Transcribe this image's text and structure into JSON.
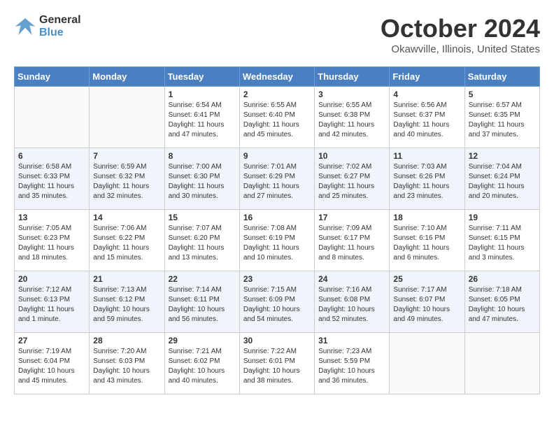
{
  "header": {
    "logo_line1": "General",
    "logo_line2": "Blue",
    "title": "October 2024",
    "subtitle": "Okawville, Illinois, United States"
  },
  "weekdays": [
    "Sunday",
    "Monday",
    "Tuesday",
    "Wednesday",
    "Thursday",
    "Friday",
    "Saturday"
  ],
  "weeks": [
    [
      {
        "day": "",
        "info": ""
      },
      {
        "day": "",
        "info": ""
      },
      {
        "day": "1",
        "info": "Sunrise: 6:54 AM\nSunset: 6:41 PM\nDaylight: 11 hours and 47 minutes."
      },
      {
        "day": "2",
        "info": "Sunrise: 6:55 AM\nSunset: 6:40 PM\nDaylight: 11 hours and 45 minutes."
      },
      {
        "day": "3",
        "info": "Sunrise: 6:55 AM\nSunset: 6:38 PM\nDaylight: 11 hours and 42 minutes."
      },
      {
        "day": "4",
        "info": "Sunrise: 6:56 AM\nSunset: 6:37 PM\nDaylight: 11 hours and 40 minutes."
      },
      {
        "day": "5",
        "info": "Sunrise: 6:57 AM\nSunset: 6:35 PM\nDaylight: 11 hours and 37 minutes."
      }
    ],
    [
      {
        "day": "6",
        "info": "Sunrise: 6:58 AM\nSunset: 6:33 PM\nDaylight: 11 hours and 35 minutes."
      },
      {
        "day": "7",
        "info": "Sunrise: 6:59 AM\nSunset: 6:32 PM\nDaylight: 11 hours and 32 minutes."
      },
      {
        "day": "8",
        "info": "Sunrise: 7:00 AM\nSunset: 6:30 PM\nDaylight: 11 hours and 30 minutes."
      },
      {
        "day": "9",
        "info": "Sunrise: 7:01 AM\nSunset: 6:29 PM\nDaylight: 11 hours and 27 minutes."
      },
      {
        "day": "10",
        "info": "Sunrise: 7:02 AM\nSunset: 6:27 PM\nDaylight: 11 hours and 25 minutes."
      },
      {
        "day": "11",
        "info": "Sunrise: 7:03 AM\nSunset: 6:26 PM\nDaylight: 11 hours and 23 minutes."
      },
      {
        "day": "12",
        "info": "Sunrise: 7:04 AM\nSunset: 6:24 PM\nDaylight: 11 hours and 20 minutes."
      }
    ],
    [
      {
        "day": "13",
        "info": "Sunrise: 7:05 AM\nSunset: 6:23 PM\nDaylight: 11 hours and 18 minutes."
      },
      {
        "day": "14",
        "info": "Sunrise: 7:06 AM\nSunset: 6:22 PM\nDaylight: 11 hours and 15 minutes."
      },
      {
        "day": "15",
        "info": "Sunrise: 7:07 AM\nSunset: 6:20 PM\nDaylight: 11 hours and 13 minutes."
      },
      {
        "day": "16",
        "info": "Sunrise: 7:08 AM\nSunset: 6:19 PM\nDaylight: 11 hours and 10 minutes."
      },
      {
        "day": "17",
        "info": "Sunrise: 7:09 AM\nSunset: 6:17 PM\nDaylight: 11 hours and 8 minutes."
      },
      {
        "day": "18",
        "info": "Sunrise: 7:10 AM\nSunset: 6:16 PM\nDaylight: 11 hours and 6 minutes."
      },
      {
        "day": "19",
        "info": "Sunrise: 7:11 AM\nSunset: 6:15 PM\nDaylight: 11 hours and 3 minutes."
      }
    ],
    [
      {
        "day": "20",
        "info": "Sunrise: 7:12 AM\nSunset: 6:13 PM\nDaylight: 11 hours and 1 minute."
      },
      {
        "day": "21",
        "info": "Sunrise: 7:13 AM\nSunset: 6:12 PM\nDaylight: 10 hours and 59 minutes."
      },
      {
        "day": "22",
        "info": "Sunrise: 7:14 AM\nSunset: 6:11 PM\nDaylight: 10 hours and 56 minutes."
      },
      {
        "day": "23",
        "info": "Sunrise: 7:15 AM\nSunset: 6:09 PM\nDaylight: 10 hours and 54 minutes."
      },
      {
        "day": "24",
        "info": "Sunrise: 7:16 AM\nSunset: 6:08 PM\nDaylight: 10 hours and 52 minutes."
      },
      {
        "day": "25",
        "info": "Sunrise: 7:17 AM\nSunset: 6:07 PM\nDaylight: 10 hours and 49 minutes."
      },
      {
        "day": "26",
        "info": "Sunrise: 7:18 AM\nSunset: 6:05 PM\nDaylight: 10 hours and 47 minutes."
      }
    ],
    [
      {
        "day": "27",
        "info": "Sunrise: 7:19 AM\nSunset: 6:04 PM\nDaylight: 10 hours and 45 minutes."
      },
      {
        "day": "28",
        "info": "Sunrise: 7:20 AM\nSunset: 6:03 PM\nDaylight: 10 hours and 43 minutes."
      },
      {
        "day": "29",
        "info": "Sunrise: 7:21 AM\nSunset: 6:02 PM\nDaylight: 10 hours and 40 minutes."
      },
      {
        "day": "30",
        "info": "Sunrise: 7:22 AM\nSunset: 6:01 PM\nDaylight: 10 hours and 38 minutes."
      },
      {
        "day": "31",
        "info": "Sunrise: 7:23 AM\nSunset: 5:59 PM\nDaylight: 10 hours and 36 minutes."
      },
      {
        "day": "",
        "info": ""
      },
      {
        "day": "",
        "info": ""
      }
    ]
  ]
}
